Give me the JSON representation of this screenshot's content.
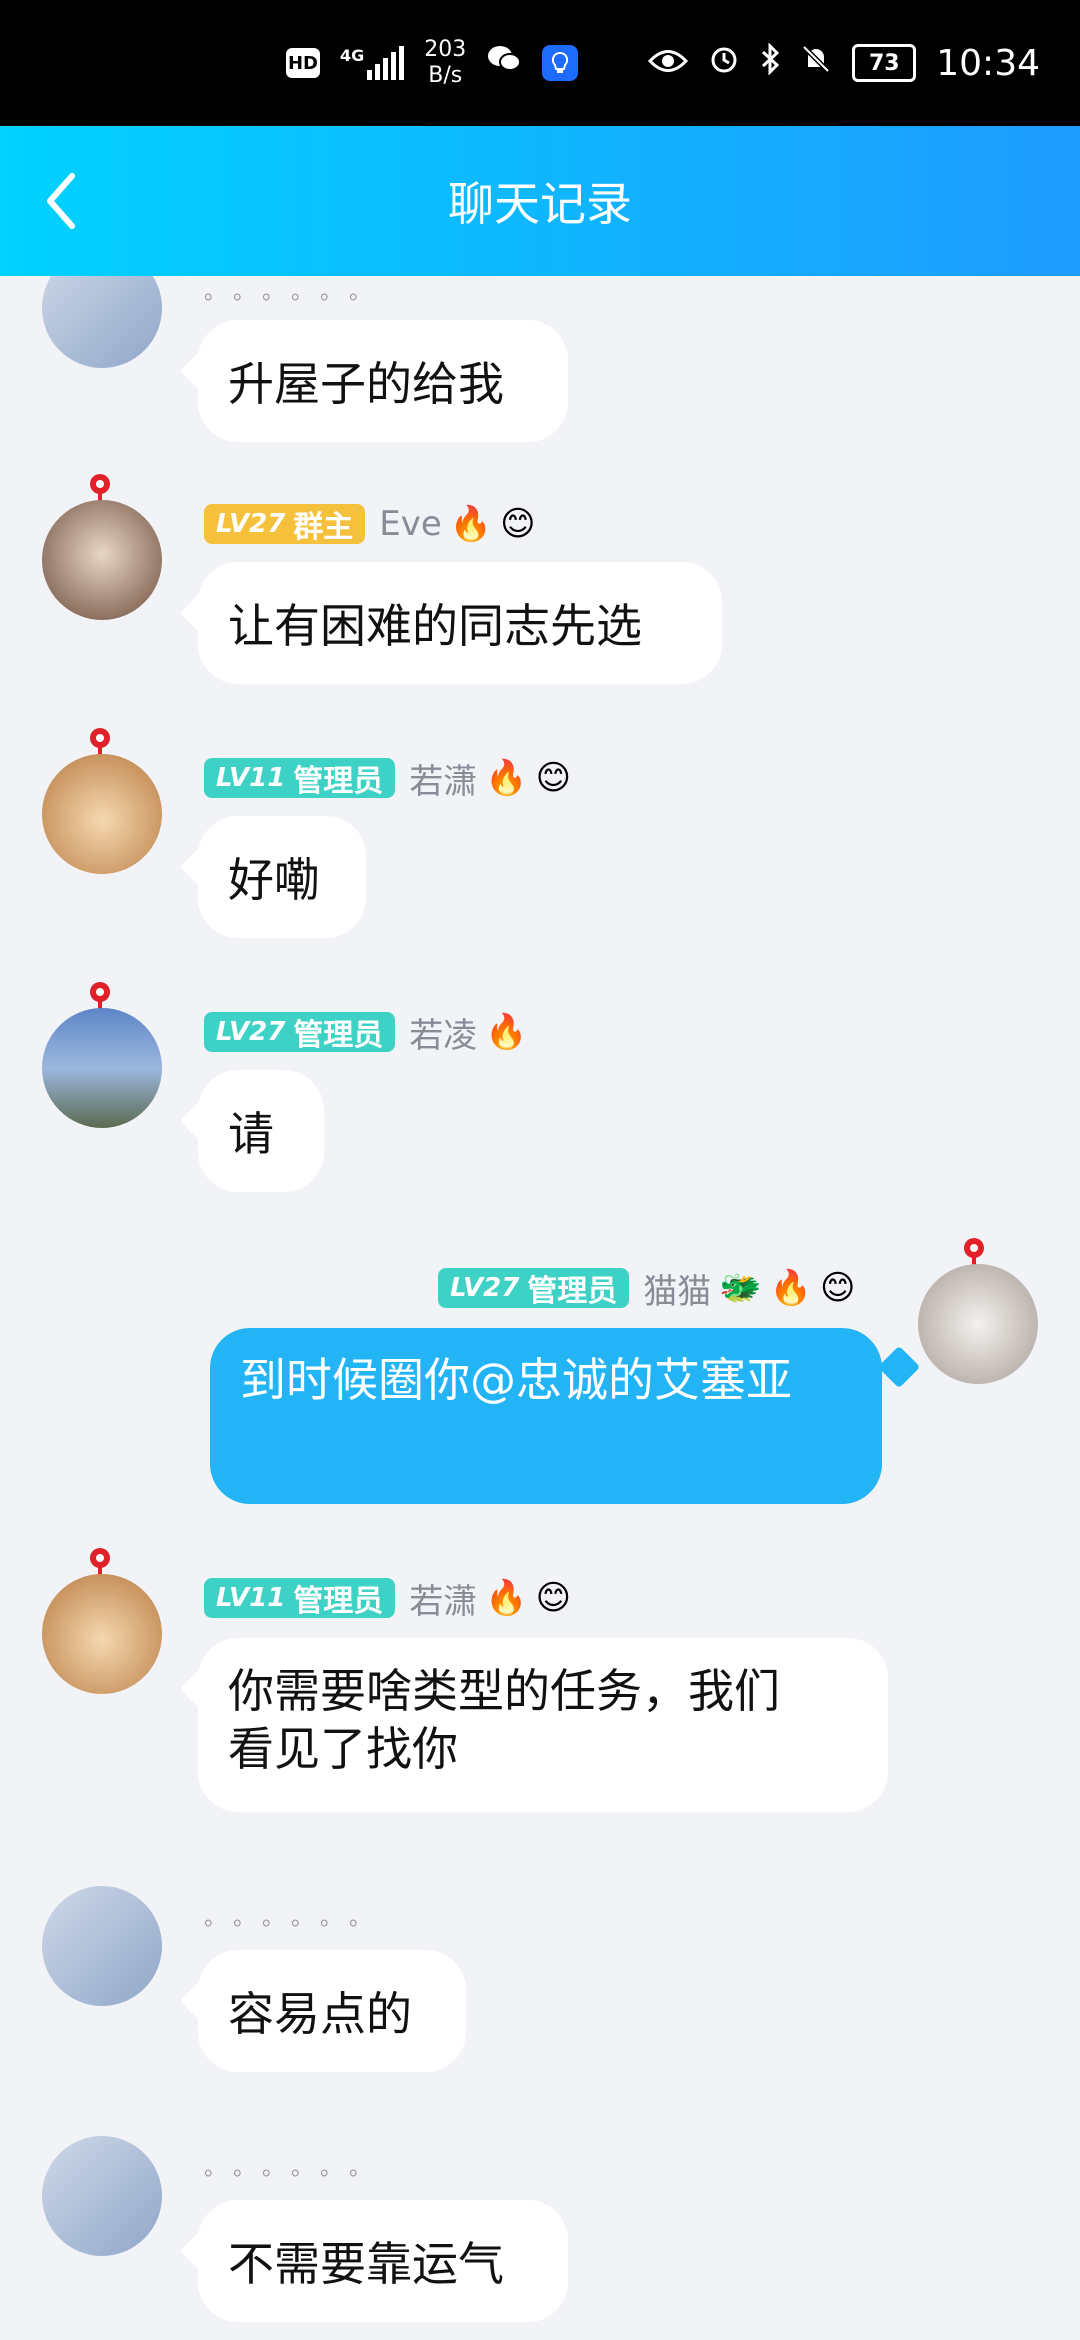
{
  "status": {
    "hd": "HD",
    "net": "4G",
    "speed_top": "203",
    "speed_bottom": "B/s",
    "battery": "73",
    "time": "10:34"
  },
  "header": {
    "title": "聊天记录"
  },
  "messages": [
    {
      "dots": "。。。。。。",
      "text": "升屋子的给我"
    },
    {
      "lv": "LV27",
      "role": "群主",
      "nick": "Eve",
      "text": "让有困难的同志先选"
    },
    {
      "lv": "LV11",
      "role": "管理员",
      "nick": "若潇",
      "text": "好嘞"
    },
    {
      "lv": "LV27",
      "role": "管理员",
      "nick": "若凌",
      "text": "请"
    },
    {
      "lv": "LV27",
      "role": "管理员",
      "nick": "猫猫",
      "text": "到时候圈你@忠诚的艾塞亚"
    },
    {
      "lv": "LV11",
      "role": "管理员",
      "nick": "若潇",
      "text_line1": "你需要啥类型的任务，我们",
      "text_line2": "看见了找你"
    },
    {
      "dots": "。。。。。。",
      "text": "容易点的"
    },
    {
      "dots": "。。。。。。",
      "text": "不需要靠运气"
    }
  ],
  "colors": {
    "header_start": "#00D2FF",
    "header_end": "#1E9BFF",
    "my_bubble": "#22B4F5",
    "owner_tag": "#F5C03B",
    "admin_tag": "#3ED1C5"
  }
}
